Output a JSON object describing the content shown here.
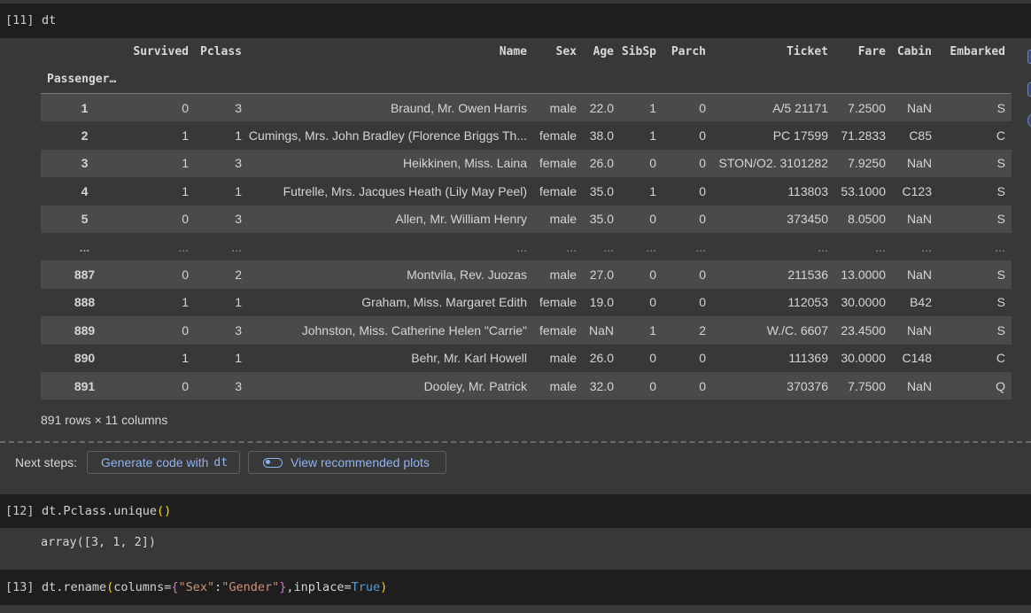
{
  "cells": {
    "c11": {
      "prompt": "[11]",
      "code": "dt"
    },
    "c12": {
      "prompt": "[12]",
      "code_a": "dt.Pclass.unique",
      "code_b": "()",
      "output": "array([3, 1, 2])"
    },
    "c13": {
      "prompt": "[13]",
      "code_a": "dt.rename",
      "code_b": "(",
      "code_c": "columns=",
      "code_d": "{",
      "code_e": "\"Sex\"",
      "code_f": ":",
      "code_g": "\"Gender\"",
      "code_h": "}",
      "code_i": ",inplace=",
      "code_j": "True",
      "code_k": ")"
    }
  },
  "dataframe": {
    "index_name": "PassengerId",
    "columns": [
      "Survived",
      "Pclass",
      "Name",
      "Sex",
      "Age",
      "SibSp",
      "Parch",
      "Ticket",
      "Fare",
      "Cabin",
      "Embarked"
    ],
    "rows": [
      [
        "1",
        "0",
        "3",
        "Braund, Mr. Owen Harris",
        "male",
        "22.0",
        "1",
        "0",
        "A/5 21171",
        "7.2500",
        "NaN",
        "S"
      ],
      [
        "2",
        "1",
        "1",
        "Cumings, Mrs. John Bradley (Florence Briggs Th...",
        "female",
        "38.0",
        "1",
        "0",
        "PC 17599",
        "71.2833",
        "C85",
        "C"
      ],
      [
        "3",
        "1",
        "3",
        "Heikkinen, Miss. Laina",
        "female",
        "26.0",
        "0",
        "0",
        "STON/O2. 3101282",
        "7.9250",
        "NaN",
        "S"
      ],
      [
        "4",
        "1",
        "1",
        "Futrelle, Mrs. Jacques Heath (Lily May Peel)",
        "female",
        "35.0",
        "1",
        "0",
        "113803",
        "53.1000",
        "C123",
        "S"
      ],
      [
        "5",
        "0",
        "3",
        "Allen, Mr. William Henry",
        "male",
        "35.0",
        "0",
        "0",
        "373450",
        "8.0500",
        "NaN",
        "S"
      ],
      [
        "...",
        "...",
        "...",
        "...",
        "...",
        "...",
        "...",
        "...",
        "...",
        "...",
        "...",
        "..."
      ],
      [
        "887",
        "0",
        "2",
        "Montvila, Rev. Juozas",
        "male",
        "27.0",
        "0",
        "0",
        "211536",
        "13.0000",
        "NaN",
        "S"
      ],
      [
        "888",
        "1",
        "1",
        "Graham, Miss. Margaret Edith",
        "female",
        "19.0",
        "0",
        "0",
        "112053",
        "30.0000",
        "B42",
        "S"
      ],
      [
        "889",
        "0",
        "3",
        "Johnston, Miss. Catherine Helen \"Carrie\"",
        "female",
        "NaN",
        "1",
        "2",
        "W./C. 6607",
        "23.4500",
        "NaN",
        "S"
      ],
      [
        "890",
        "1",
        "1",
        "Behr, Mr. Karl Howell",
        "male",
        "26.0",
        "0",
        "0",
        "111369",
        "30.0000",
        "C148",
        "C"
      ],
      [
        "891",
        "0",
        "3",
        "Dooley, Mr. Patrick",
        "male",
        "32.0",
        "0",
        "0",
        "370376",
        "7.7500",
        "NaN",
        "Q"
      ]
    ],
    "dims": "891 rows × 11 columns"
  },
  "next_steps": {
    "label": "Next steps:",
    "generate_label": "Generate code with",
    "generate_var": "dt",
    "plots_label": "View recommended plots"
  },
  "colors": {
    "accent": "#8fb3f2",
    "code_bg": "#1e1e1e",
    "output_bg": "#383838"
  },
  "icons": [
    "toggle-icon",
    "table-icon",
    "chart-icon",
    "magic-icon"
  ]
}
